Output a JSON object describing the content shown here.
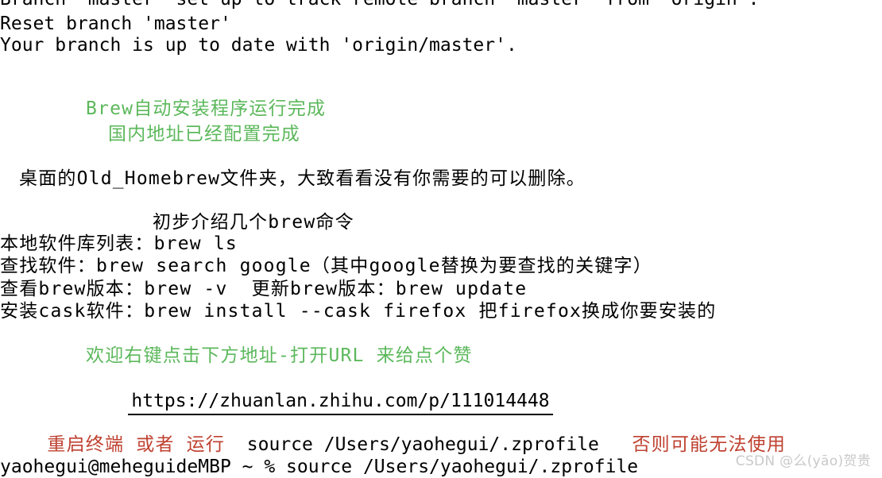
{
  "terminal": {
    "background_color": "#ffffff",
    "default_text_color": "#000000",
    "green_color": "#5cb85c",
    "red_color": "#bf4130",
    "lines": {
      "git_branch_track": "Branch 'master' set up to track remote branch 'master' from 'origin'.",
      "git_reset_branch": "Reset branch 'master'",
      "git_up_to_date": "Your branch is up to date with 'origin/master'.",
      "brew_done_title": "Brew自动安装程序运行完成",
      "brew_done_subtitle": "国内地址已经配置完成",
      "desktop_note": "桌面的Old_Homebrew文件夹，大致看看没有你需要的可以删除。",
      "commands_heading": "初步介绍几个brew命令",
      "cmd_list_local": "本地软件库列表：brew ls",
      "cmd_search": "查找软件：brew search google（其中google替换为要查找的关键字）",
      "cmd_version": "查看brew版本：brew -v  更新brew版本：brew update",
      "cmd_cask": "安装cask软件：brew install --cask firefox 把firefox换成你要安装的",
      "like_prompt": "欢迎右键点击下方地址-打开URL 来给点个赞",
      "url": "https://zhuanlan.zhihu.com/p/111014448",
      "restart_prefix": "重启终端 或者 运行",
      "restart_command": "source /Users/yaohegui/.zprofile",
      "restart_suffix": "否则可能无法使用",
      "shell_prompt": "yaohegui@meheguideMBP ~ % source /Users/yaohegui/.zprofile"
    }
  },
  "watermark": {
    "text": "CSDN @么(yāo)贺贵"
  }
}
